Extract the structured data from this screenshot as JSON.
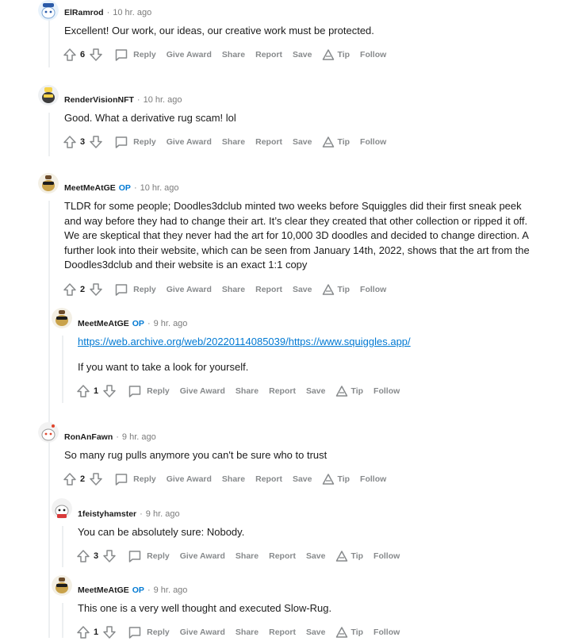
{
  "comments": [
    {
      "username": "ElRamrod",
      "op": "",
      "time": "10 hr. ago",
      "body": [
        "Excellent! Our work, our ideas, our creative work must be protected."
      ],
      "votes": "6"
    },
    {
      "username": "RenderVisionNFT",
      "op": "",
      "time": "10 hr. ago",
      "body": [
        "Good. What a derivative rug scam! lol"
      ],
      "votes": "3"
    },
    {
      "username": "MeetMeAtGE",
      "op": "OP",
      "time": "10 hr. ago",
      "body": [
        "TLDR for some people; Doodles3dclub minted two weeks before Squiggles did their first sneak peek and way before they had to change their art. It’s clear they created that other collection or ripped it off. We are skeptical that they never had the art for 10,000 3D doodles and decided to change direction. A further look into their website, which can be seen from January 14th, 2022, shows that the art from the Doodles3dclub and their website is an exact 1:1 copy"
      ],
      "votes": "2"
    },
    {
      "username": "MeetMeAtGE",
      "op": "OP",
      "time": "9 hr. ago",
      "link": "https://web.archive.org/web/20220114085039/https://www.squiggles.app/",
      "body": [
        "If you want to take a look for yourself."
      ],
      "votes": "1"
    },
    {
      "username": "RonAnFawn",
      "op": "",
      "time": "9 hr. ago",
      "body": [
        "So many rug pulls anymore you can't be sure who to trust"
      ],
      "votes": "2"
    },
    {
      "username": "1feistyhamster",
      "op": "",
      "time": "9 hr. ago",
      "body": [
        "You can be absolutely sure: Nobody."
      ],
      "votes": "3"
    },
    {
      "username": "MeetMeAtGE",
      "op": "OP",
      "time": "9 hr. ago",
      "body": [
        "This one is a very well thought and executed Slow-Rug."
      ],
      "votes": "1"
    }
  ],
  "actions": {
    "reply": "Reply",
    "give_award": "Give Award",
    "share": "Share",
    "report": "Report",
    "save": "Save",
    "tip": "Tip",
    "follow": "Follow"
  },
  "colors": {
    "text": "#1c1c1c",
    "muted": "#878a8c",
    "link": "#0079d3",
    "op": "#0079d3",
    "thread_line": "#edeff1"
  }
}
